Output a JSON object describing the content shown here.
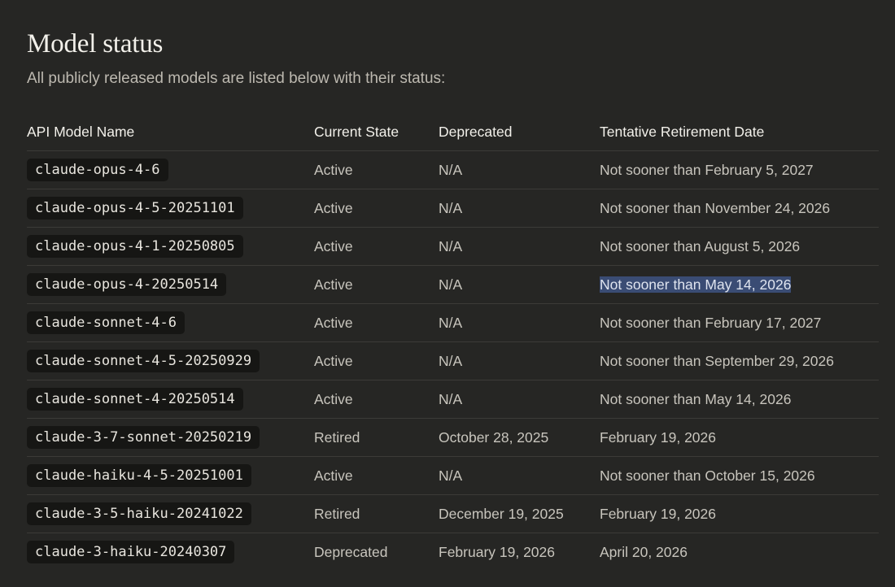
{
  "heading": "Model status",
  "subtitle": "All publicly released models are listed below with their status:",
  "table": {
    "headers": [
      "API Model Name",
      "Current State",
      "Deprecated",
      "Tentative Retirement Date"
    ],
    "rows": [
      {
        "model": "claude-opus-4-6",
        "state": "Active",
        "deprecated": "N/A",
        "retirement": "Not sooner than February 5, 2027"
      },
      {
        "model": "claude-opus-4-5-20251101",
        "state": "Active",
        "deprecated": "N/A",
        "retirement": "Not sooner than November 24, 2026"
      },
      {
        "model": "claude-opus-4-1-20250805",
        "state": "Active",
        "deprecated": "N/A",
        "retirement": "Not sooner than August 5, 2026"
      },
      {
        "model": "claude-opus-4-20250514",
        "state": "Active",
        "deprecated": "N/A",
        "retirement": "Not sooner than May 14, 2026",
        "selected": true
      },
      {
        "model": "claude-sonnet-4-6",
        "state": "Active",
        "deprecated": "N/A",
        "retirement": "Not sooner than February 17, 2027"
      },
      {
        "model": "claude-sonnet-4-5-20250929",
        "state": "Active",
        "deprecated": "N/A",
        "retirement": "Not sooner than September 29, 2026"
      },
      {
        "model": "claude-sonnet-4-20250514",
        "state": "Active",
        "deprecated": "N/A",
        "retirement": "Not sooner than May 14, 2026"
      },
      {
        "model": "claude-3-7-sonnet-20250219",
        "state": "Retired",
        "deprecated": "October 28, 2025",
        "retirement": "February 19, 2026"
      },
      {
        "model": "claude-haiku-4-5-20251001",
        "state": "Active",
        "deprecated": "N/A",
        "retirement": "Not sooner than October 15, 2026"
      },
      {
        "model": "claude-3-5-haiku-20241022",
        "state": "Retired",
        "deprecated": "December 19, 2025",
        "retirement": "February 19, 2026"
      },
      {
        "model": "claude-3-haiku-20240307",
        "state": "Deprecated",
        "deprecated": "February 19, 2026",
        "retirement": "April 20, 2026"
      }
    ]
  },
  "colors": {
    "background": "#262624",
    "code_background": "#161614",
    "selection_highlight": "#3a4c74"
  }
}
